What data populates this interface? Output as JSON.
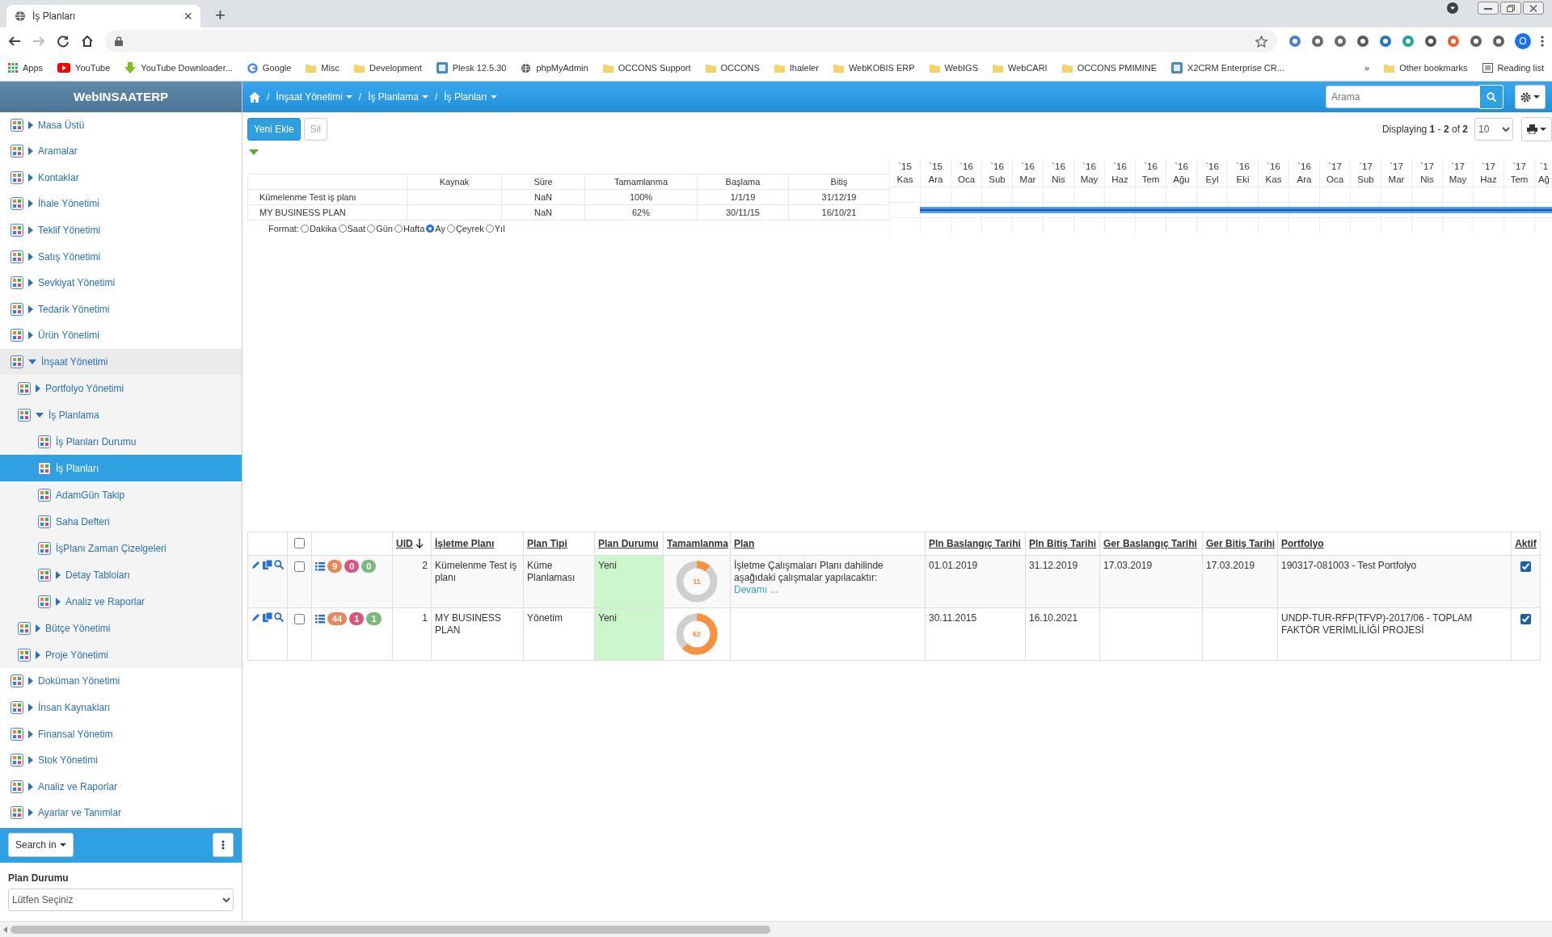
{
  "browser": {
    "tab_title": "İş Planları",
    "tab_close": "×",
    "new_tab": "+",
    "profile": "O",
    "bookmarks": [
      {
        "label": "Apps",
        "kind": "apps"
      },
      {
        "label": "YouTube",
        "kind": "video"
      },
      {
        "label": "YouTube Downloader...",
        "kind": "download"
      },
      {
        "label": "Google",
        "kind": "search"
      },
      {
        "label": "Misc",
        "kind": "folder"
      },
      {
        "label": "Development",
        "kind": "folder"
      },
      {
        "label": "Plesk 12.5.30",
        "kind": "site"
      },
      {
        "label": "phpMyAdmin",
        "kind": "globe"
      },
      {
        "label": "OCCONS Support",
        "kind": "folder"
      },
      {
        "label": "OCCONS",
        "kind": "folder"
      },
      {
        "label": "Ihaleler",
        "kind": "folder"
      },
      {
        "label": "WebKOBIS ERP",
        "kind": "folder"
      },
      {
        "label": "WebIGS",
        "kind": "folder"
      },
      {
        "label": "WebCARI",
        "kind": "folder"
      },
      {
        "label": "OCCONS PMIMINE",
        "kind": "folder"
      },
      {
        "label": "X2CRM Enterprise CR...",
        "kind": "site"
      }
    ],
    "overflow": "»",
    "other_bookmarks": "Other bookmarks",
    "reading_list": "Reading list"
  },
  "sidebar": {
    "title": "WebINSAATERP",
    "items": [
      {
        "label": "Masa Üstü",
        "expanded": false,
        "selected": false
      },
      {
        "label": "Aramalar",
        "expanded": false,
        "selected": false
      },
      {
        "label": "Kontaklar",
        "expanded": false,
        "selected": false
      },
      {
        "label": "İhale Yönetimi",
        "expanded": false,
        "selected": false
      },
      {
        "label": "Teklif Yönetimi",
        "expanded": false,
        "selected": false
      },
      {
        "label": "Satış Yönetimi",
        "expanded": false,
        "selected": false
      },
      {
        "label": "Sevkiyat Yönetimi",
        "expanded": false,
        "selected": false
      },
      {
        "label": "Tedarik Yönetimi",
        "expanded": false,
        "selected": false
      },
      {
        "label": "Ürün Yönetimi",
        "expanded": false,
        "selected": false
      },
      {
        "label": "İnşaat Yönetimi",
        "expanded": true,
        "selected": false,
        "children": [
          {
            "label": "Portfolyo Yönetimi",
            "expanded": false,
            "selected": false
          },
          {
            "label": "İş Planlama",
            "expanded": true,
            "selected": false,
            "children": [
              {
                "label": "İş Planları Durumu",
                "selected": false
              },
              {
                "label": "İş Planları",
                "selected": true
              },
              {
                "label": "AdamGün Takip",
                "selected": false
              },
              {
                "label": "Saha Defteri",
                "selected": false
              },
              {
                "label": "İşPlanı Zaman Çizelgeleri",
                "selected": false
              },
              {
                "label": "Detay Tabloları",
                "expanded": false,
                "selected": false
              },
              {
                "label": "Analiz ve Raporlar",
                "expanded": false,
                "selected": false
              }
            ]
          },
          {
            "label": "Bütçe Yönetimi",
            "expanded": false,
            "selected": false
          },
          {
            "label": "Proje Yönetimi",
            "expanded": false,
            "selected": false
          }
        ]
      },
      {
        "label": "Doküman Yönetimi",
        "expanded": false,
        "selected": false
      },
      {
        "label": "İnsan Kaynakları",
        "expanded": false,
        "selected": false
      },
      {
        "label": "Finansal Yönetim",
        "expanded": false,
        "selected": false
      },
      {
        "label": "Stok Yönetimi",
        "expanded": false,
        "selected": false
      },
      {
        "label": "Analiz ve Raporlar",
        "expanded": false,
        "selected": false
      },
      {
        "label": "Ayarlar ve Tanımlar",
        "expanded": false,
        "selected": false
      }
    ],
    "search_button": "Search in",
    "filter_label": "Plan Durumu",
    "filter_value": "Lütfen Seçiniz"
  },
  "header": {
    "breadcrumb": [
      {
        "separator": "/",
        "label": "İnşaat Yönetimi"
      },
      {
        "separator": "/",
        "label": "İş Planlama"
      },
      {
        "separator": "/",
        "label": "İş Planları"
      }
    ],
    "search_placeholder": "Arama"
  },
  "toolbar": {
    "buttons": [
      {
        "label": "Yeni Ekle",
        "kind": "primary",
        "disabled": false
      },
      {
        "label": "Sil",
        "kind": "default",
        "disabled": true
      }
    ],
    "paging": "Displaying **1** - **2** of **2**",
    "page_size": "10"
  },
  "gantt": {
    "columns": [
      "Kaynak",
      "Süre",
      "Tamamlanma",
      "Başlama",
      "Bitiş"
    ],
    "rows": [
      {
        "name": "Kümelenme Test iş planı",
        "duration": "NaN",
        "completion": "100%",
        "start": "1/1/19",
        "end": "31/12/19"
      },
      {
        "name": "MY BUSINESS PLAN",
        "duration": "NaN",
        "completion": "62%",
        "start": "30/11/15",
        "end": "16/10/21"
      }
    ],
    "format_label": "Format:",
    "formats": [
      {
        "label": "Dakika",
        "selected": false
      },
      {
        "label": "Saat",
        "selected": false
      },
      {
        "label": "Gün",
        "selected": false
      },
      {
        "label": "Hafta",
        "selected": false
      },
      {
        "label": "Ay",
        "selected": true
      },
      {
        "label": "Çeyrek",
        "selected": false
      },
      {
        "label": "Yıl",
        "selected": false
      }
    ],
    "timeline": [
      {
        "year": "`15",
        "month": "Kas"
      },
      {
        "year": "`15",
        "month": "Ara"
      },
      {
        "year": "`16",
        "month": "Oca"
      },
      {
        "year": "`16",
        "month": "Sub"
      },
      {
        "year": "`16",
        "month": "Mar"
      },
      {
        "year": "`16",
        "month": "Nis"
      },
      {
        "year": "`16",
        "month": "May"
      },
      {
        "year": "`16",
        "month": "Haz"
      },
      {
        "year": "`16",
        "month": "Tem"
      },
      {
        "year": "`16",
        "month": "Ağu"
      },
      {
        "year": "`16",
        "month": "Eyl"
      },
      {
        "year": "`16",
        "month": "Eki"
      },
      {
        "year": "`16",
        "month": "Kas"
      },
      {
        "year": "`16",
        "month": "Ara"
      },
      {
        "year": "`17",
        "month": "Oca"
      },
      {
        "year": "`17",
        "month": "Sub"
      },
      {
        "year": "`17",
        "month": "Mar"
      },
      {
        "year": "`17",
        "month": "Nis"
      },
      {
        "year": "`17",
        "month": "May"
      },
      {
        "year": "`17",
        "month": "Haz"
      },
      {
        "year": "`17",
        "month": "Tem"
      },
      {
        "year": "`1",
        "month": "Ağ"
      }
    ]
  },
  "table": {
    "select_all": {
      "checked": false
    },
    "columns": [
      {
        "label": "UID",
        "sorted": true
      },
      {
        "label": "İşletme Planı",
        "sorted": false
      },
      {
        "label": "Plan Tipi",
        "sorted": false
      },
      {
        "label": "Plan Durumu",
        "sorted": false
      },
      {
        "label": "Tamamlanma",
        "sorted": false
      },
      {
        "label": "Plan",
        "sorted": false
      },
      {
        "label": "Pln Baslangıç Tarihi",
        "sorted": false
      },
      {
        "label": "Pln Bitiş Tarihi",
        "sorted": false
      },
      {
        "label": "Ger Baslangıç Tarihi",
        "sorted": false
      },
      {
        "label": "Ger Bitiş Tarihi",
        "sorted": false
      },
      {
        "label": "Portfolyo",
        "sorted": false
      },
      {
        "label": "Aktif",
        "sorted": false
      }
    ],
    "rows": [
      {
        "checked": false,
        "badges": [
          {
            "count": "9",
            "color": "#e8875a"
          },
          {
            "count": "0",
            "color": "#d9577e"
          },
          {
            "count": "0",
            "color": "#7cb87c"
          }
        ],
        "uid": "2",
        "name": "Kümelenme Test iş planı",
        "type": "Küme Planlaması",
        "status": "Yeni",
        "completion": {
          "level": 0.11,
          "label": "11"
        },
        "plan": "İşletme Çalışmaları Planı dahilinde aşağıdaki çalışmalar yapılacaktır:",
        "more_link": "Devamı ...",
        "pln_start": "01.01.2019",
        "pln_end": "31.12.2019",
        "ger_start": "17.03.2019",
        "ger_end": "17.03.2019",
        "portfolio": "190317-081003 - Test Portfolyo",
        "active": true
      },
      {
        "checked": false,
        "badges": [
          {
            "count": "44",
            "color": "#e8875a"
          },
          {
            "count": "1",
            "color": "#d9577e"
          },
          {
            "count": "1",
            "color": "#7cb87c"
          }
        ],
        "uid": "1",
        "name": "MY BUSINESS PLAN",
        "type": "Yönetim",
        "status": "Yeni",
        "completion": {
          "level": 0.62,
          "label": "62"
        },
        "pln_start": "30.11.2015",
        "pln_end": "16.10.2021",
        "portfolio": "UNDP-TUR-RFP(TFVP)-2017/06 - TOPLAM FAKTÖR VERİMLİLİĞİ PROJESİ",
        "active": true
      }
    ]
  }
}
